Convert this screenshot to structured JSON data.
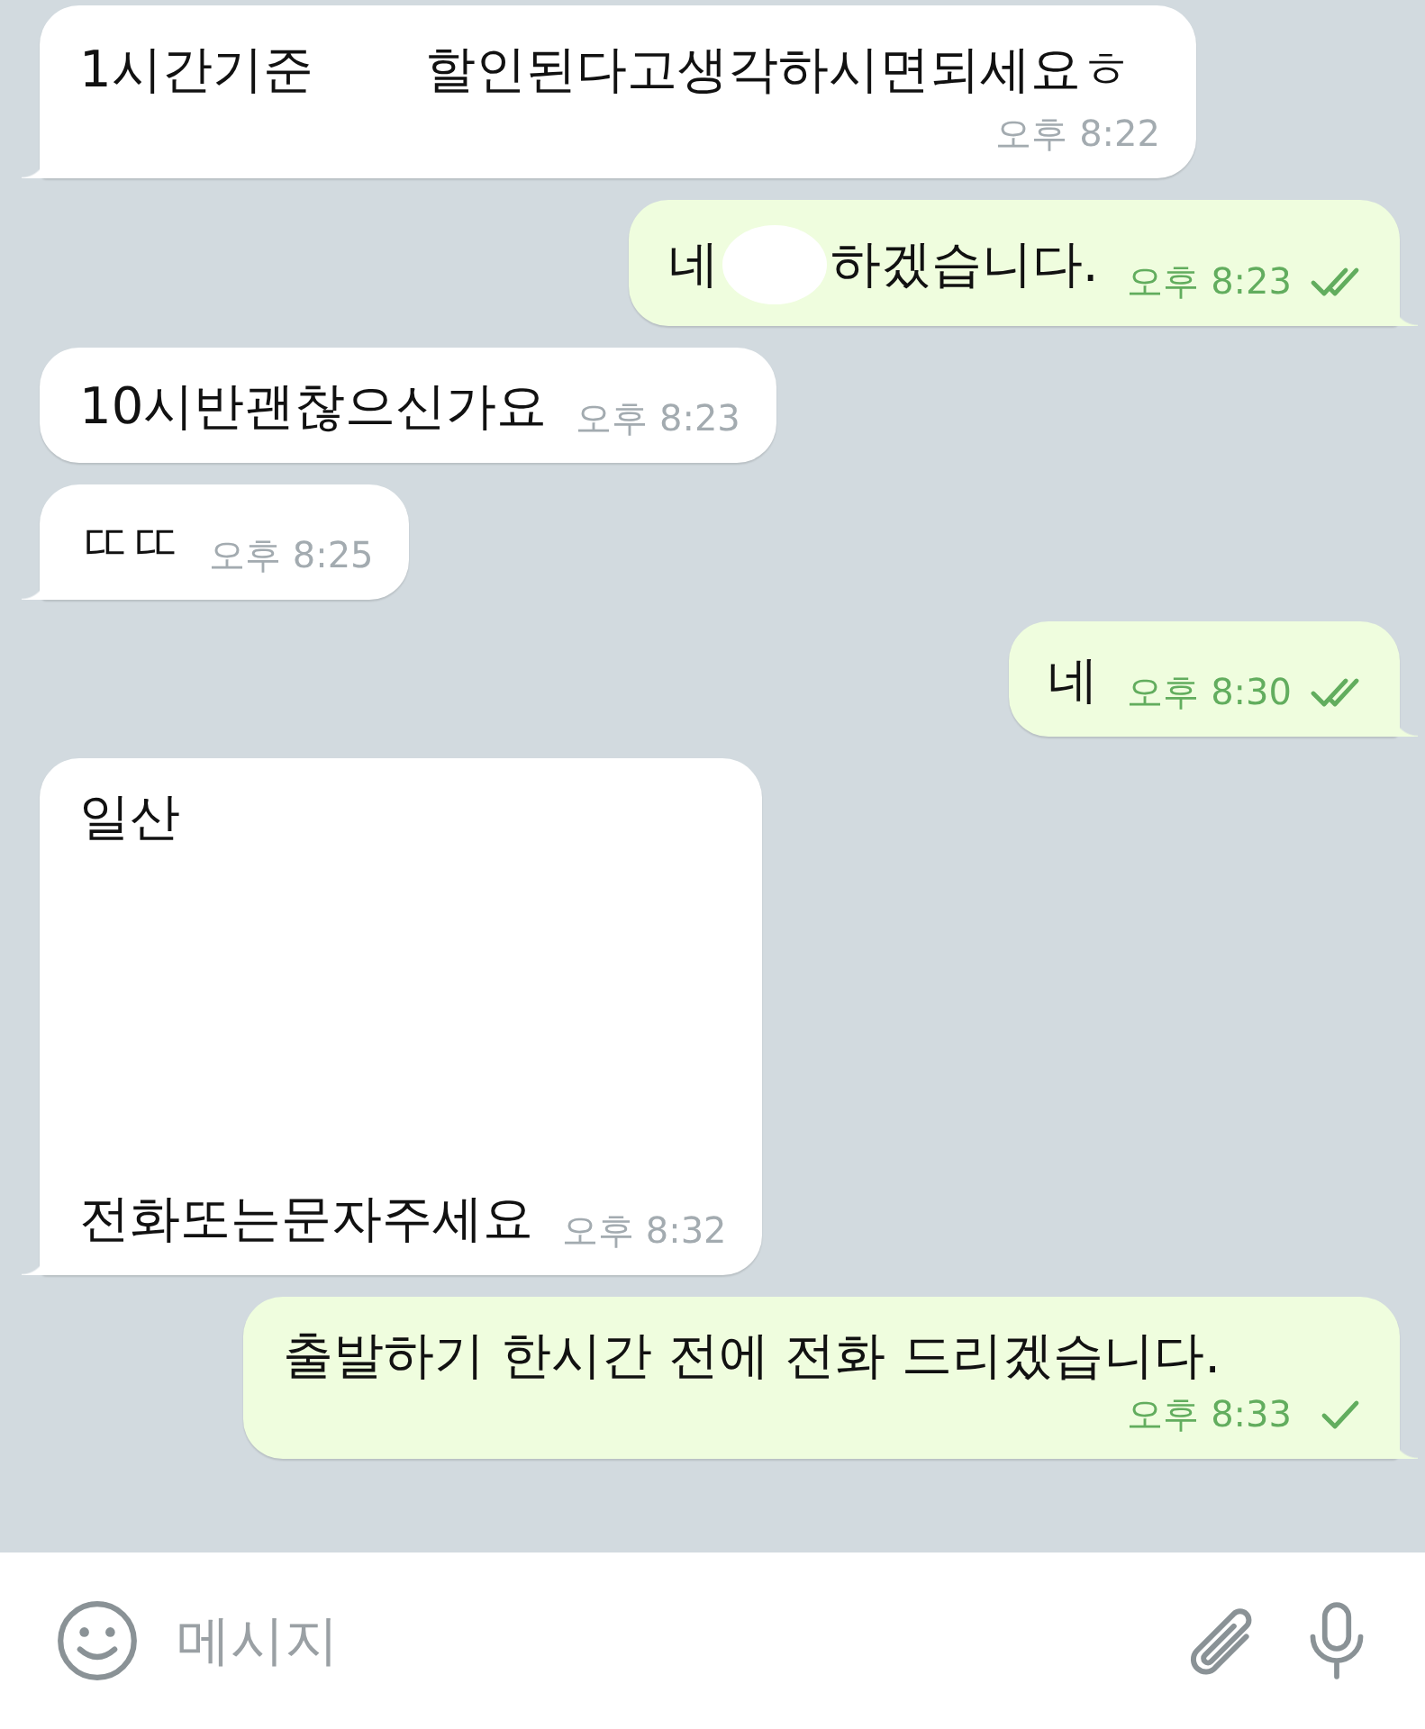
{
  "messages": [
    {
      "kind": "incoming",
      "tail": true,
      "segments": [
        {
          "kind": "text",
          "text": "1시간기준"
        },
        {
          "kind": "redacted"
        },
        {
          "kind": "text",
          "text": "할인된다고생각하시면되세요ㅎ"
        }
      ],
      "time": "오후 8:22"
    },
    {
      "kind": "outgoing",
      "tail": true,
      "segments": [
        {
          "kind": "text",
          "text": "네"
        },
        {
          "kind": "redacted"
        },
        {
          "kind": "text",
          "text": "하겠습니다."
        }
      ],
      "time": "오후 8:23",
      "read": true
    },
    {
      "kind": "incoming",
      "tail": false,
      "segments": [
        {
          "kind": "text",
          "text": "10시반괜찮으신가요"
        }
      ],
      "time": "오후 8:23"
    },
    {
      "kind": "incoming",
      "tail": true,
      "segments": [
        {
          "kind": "text",
          "text": "ㄸㄸ"
        }
      ],
      "time": "오후 8:25"
    },
    {
      "kind": "outgoing",
      "tail": true,
      "segments": [
        {
          "kind": "text",
          "text": "네"
        }
      ],
      "time": "오후 8:30",
      "read": true
    },
    {
      "kind": "incoming",
      "tail": true,
      "segments": [
        {
          "kind": "text",
          "text": "일산"
        },
        {
          "kind": "redacted_block"
        },
        {
          "kind": "text",
          "text": "전화또는문자주세요"
        }
      ],
      "time": "오후 8:32"
    },
    {
      "kind": "outgoing",
      "tail": true,
      "segments": [
        {
          "kind": "text",
          "text": "출발하기 한시간 전에 전화 드리겠습니다."
        }
      ],
      "time": "오후 8:33",
      "read": false
    }
  ],
  "composer": {
    "placeholder": "메시지"
  }
}
